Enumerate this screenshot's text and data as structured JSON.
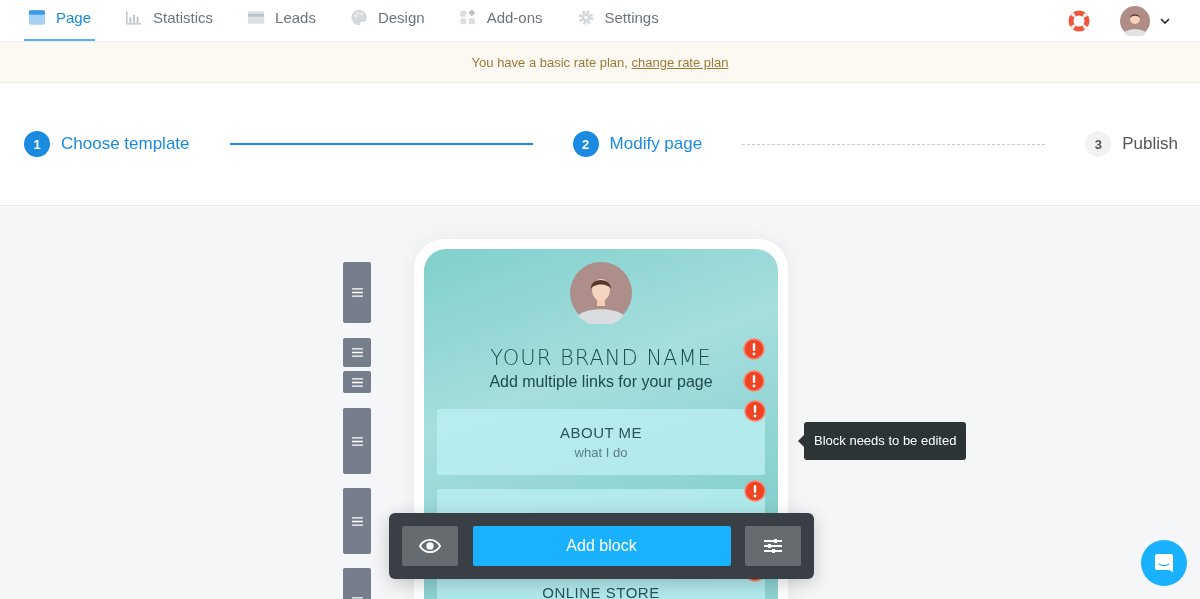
{
  "nav": {
    "tabs": [
      {
        "label": "Page",
        "selected": true
      },
      {
        "label": "Statistics",
        "selected": false
      },
      {
        "label": "Leads",
        "selected": false
      },
      {
        "label": "Design",
        "selected": false
      },
      {
        "label": "Add-ons",
        "selected": false
      },
      {
        "label": "Settings",
        "selected": false
      }
    ]
  },
  "banner": {
    "text": "You have a basic rate plan, ",
    "link": "change rate plan"
  },
  "steps": [
    {
      "number": "1",
      "label": "Choose template",
      "active": true
    },
    {
      "number": "2",
      "label": "Modify page",
      "active": true
    },
    {
      "number": "3",
      "label": "Publish",
      "active": false
    }
  ],
  "blocks": [
    {
      "kind": "avatar",
      "warning": false
    },
    {
      "kind": "title",
      "text": "YOUR BRAND NAME",
      "warning": true
    },
    {
      "kind": "subtitle",
      "text": "Add multiple links for your page",
      "warning": true
    },
    {
      "kind": "link",
      "text": "ABOUT ME",
      "subtext": "what I do",
      "warning": true
    },
    {
      "kind": "link",
      "warning": true
    },
    {
      "kind": "link",
      "text": "ONLINE STORE",
      "warning": true
    }
  ],
  "toolbar": {
    "add_label": "Add block"
  },
  "tooltip": "Block needs to be edited"
}
